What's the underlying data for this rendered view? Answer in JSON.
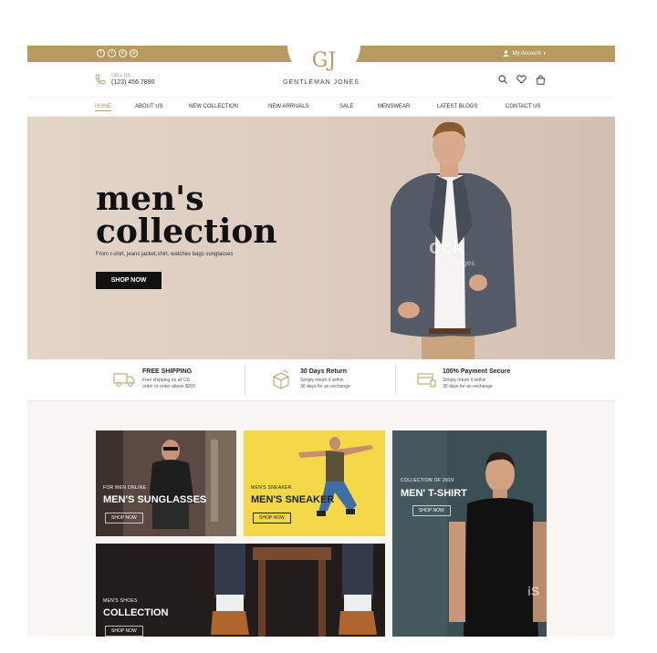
{
  "topbar": {
    "socials": [
      "facebook-icon",
      "twitter-icon",
      "pinterest-icon",
      "instagram-icon"
    ],
    "account_label": "My Account"
  },
  "header": {
    "logo_text": "GJ",
    "brand": "GENTLEMAN JONES",
    "call_label": "CALL US",
    "phone": "(123) 456 7890"
  },
  "nav": {
    "items": [
      "HOME",
      "ABOUT US",
      "NEW COLLECTION",
      "NEW ARRIVALS",
      "SALE",
      "MENSWEAR",
      "LATEST BLOGS",
      "CONTACT US"
    ],
    "active": "HOME"
  },
  "hero": {
    "title_line1": "men's",
    "title_line2": "collection",
    "subtitle": "From t-shirt, jeans jacket,shirt, watches bags sunglasses",
    "button": "SHOP NOW",
    "watermark": "ock",
    "watermark_sub": "Images"
  },
  "features": [
    {
      "title": "FREE SHIPPING",
      "line1": "Free shipping on all US",
      "line2": "order or order above $200",
      "icon": "truck-icon"
    },
    {
      "title": "30 Days Return",
      "line1": "Simply return it within",
      "line2": "30 days for an exchange",
      "icon": "box-return-icon"
    },
    {
      "title": "100% Payment Secure",
      "line1": "Simply return it within",
      "line2": "30 days for an exchange",
      "icon": "secure-payment-icon"
    }
  ],
  "tiles": {
    "sunglasses": {
      "caption": "FOR MEN ONLINE",
      "title": "MEN'S SUNGLASSES",
      "button": "SHOP NOW"
    },
    "sneaker": {
      "caption": "MEN'S SNEAKER",
      "title": "MEN'S SNEAKER",
      "button": "SHOP NOW"
    },
    "tshirt": {
      "caption": "COLLECTION OF 2019",
      "title": "MEN' T-SHIRT",
      "button": "SHOP NOW",
      "watermark": "iS"
    },
    "shoes": {
      "caption": "MEN'S SHOES",
      "title": "COLLECTION",
      "button": "SHOP NOW"
    }
  },
  "colors": {
    "accent": "#b89a62",
    "dark": "#111111",
    "yellow": "#f5d84a"
  }
}
